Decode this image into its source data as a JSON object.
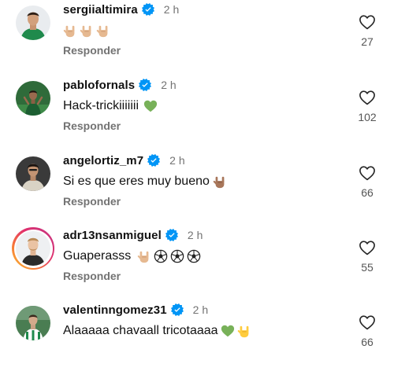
{
  "comments": [
    {
      "username": "sergiialtimira",
      "time": "2 h",
      "text": "",
      "emojis": [
        "rock-hand-icon",
        "rock-hand-icon",
        "rock-hand-icon"
      ],
      "reply_label": "Responder",
      "likes": "27",
      "avatar_style": "green-kit"
    },
    {
      "username": "pablofornals",
      "time": "2 h",
      "text": "Hack-trickiiiiiii",
      "emojis": [
        "green-heart-icon"
      ],
      "reply_label": "Responder",
      "likes": "102",
      "avatar_style": "green-pitch"
    },
    {
      "username": "angelortiz_m7",
      "time": "2 h",
      "text": "Si es que eres muy bueno",
      "emojis": [
        "rock-hand-dark-icon"
      ],
      "reply_label": "Responder",
      "likes": "66",
      "avatar_style": "dark"
    },
    {
      "username": "adr13nsanmiguel",
      "time": "2 h",
      "text": "Guaperasss",
      "emojis": [
        "rock-hand-icon",
        "soccer-ball-icon",
        "soccer-ball-icon",
        "soccer-ball-icon"
      ],
      "reply_label": "Responder",
      "likes": "55",
      "avatar_style": "story-light"
    },
    {
      "username": "valentinngomez31",
      "time": "2 h",
      "text": "Alaaaaa chavaall tricotaaaa",
      "emojis": [
        "green-heart-icon",
        "rock-hand-yellow-icon"
      ],
      "reply_label": "",
      "likes": "66",
      "avatar_style": "green-stripes"
    }
  ],
  "colors": {
    "verified_blue": "#0095f6",
    "muted_text": "#737373",
    "green_heart": "#78b159"
  }
}
